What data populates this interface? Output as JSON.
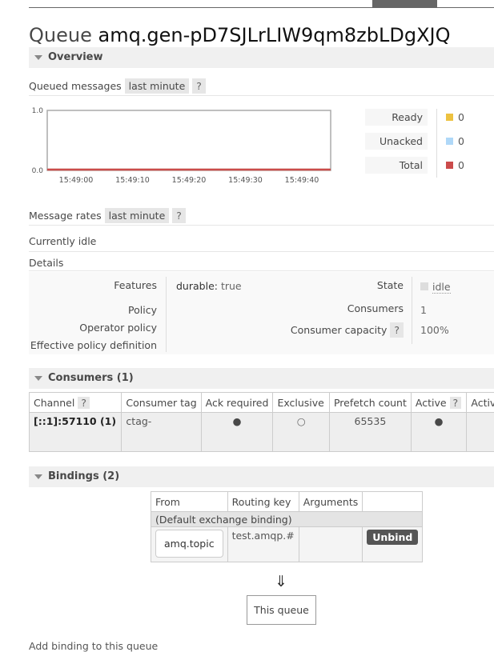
{
  "header": {
    "title_prefix": "Queue",
    "queue_name": "amq.gen-pD7SJLrLIW9qm8zbLDgXJQ"
  },
  "overview": {
    "label": "Overview",
    "queued_messages_label": "Queued messages",
    "range_label": "last minute",
    "help": "?",
    "legend": [
      {
        "label": "Ready",
        "value": "0",
        "color": "#edc240"
      },
      {
        "label": "Unacked",
        "value": "0",
        "color": "#afd8f8"
      },
      {
        "label": "Total",
        "value": "0",
        "color": "#cb4b4b"
      }
    ],
    "message_rates_label": "Message rates",
    "idle_text": "Currently idle",
    "details_label": "Details"
  },
  "chart_data": {
    "type": "line",
    "x_ticks": [
      "15:49:00",
      "15:49:10",
      "15:49:20",
      "15:49:30",
      "15:49:40"
    ],
    "y_ticks": [
      "0.0",
      "1.0"
    ],
    "ylim": [
      0,
      1
    ],
    "series": [
      {
        "name": "Ready",
        "values": [
          0,
          0,
          0,
          0,
          0
        ]
      },
      {
        "name": "Unacked",
        "values": [
          0,
          0,
          0,
          0,
          0
        ]
      },
      {
        "name": "Total",
        "values": [
          0,
          0,
          0,
          0,
          0
        ]
      }
    ]
  },
  "details": {
    "features_label": "Features",
    "durable_key": "durable:",
    "durable_value": "true",
    "policy_label": "Policy",
    "operator_policy_label": "Operator policy",
    "effective_policy_label": "Effective policy definition",
    "state_label": "State",
    "state_value": "idle",
    "consumers_label": "Consumers",
    "consumers_value": "1",
    "consumer_capacity_label": "Consumer capacity",
    "consumer_capacity_value": "100%"
  },
  "consumers": {
    "section_label": "Consumers (1)",
    "headers": [
      "Channel",
      "Consumer tag",
      "Ack required",
      "Exclusive",
      "Prefetch count",
      "Active",
      "Activit"
    ],
    "row": {
      "channel": "[::1]:57110 (1)",
      "tag": "ctag-",
      "ack_required": "●",
      "exclusive": "○",
      "prefetch": "65535",
      "active": "●"
    }
  },
  "bindings": {
    "section_label": "Bindings (2)",
    "headers": [
      "From",
      "Routing key",
      "Arguments",
      ""
    ],
    "default_row": "(Default exchange binding)",
    "from": "amq.topic",
    "routing_key": "test.amqp.#",
    "unbind_label": "Unbind",
    "arrow": "⇓",
    "this_queue": "This queue",
    "add_binding": "Add binding to this queue"
  }
}
